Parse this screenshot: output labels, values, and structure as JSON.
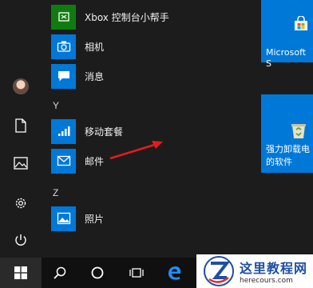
{
  "app_list": {
    "items_top": [
      {
        "label": "Xbox 控制台小帮手",
        "color": "#107c10",
        "icon": "xbox-icon"
      },
      {
        "label": "相机",
        "color": "#0078d7",
        "icon": "camera-icon"
      },
      {
        "label": "消息",
        "color": "#0078d7",
        "icon": "message-icon"
      }
    ],
    "section_y": "Y",
    "items_y": [
      {
        "label": "移动套餐",
        "color": "#0078d7",
        "icon": "signal-icon"
      },
      {
        "label": "邮件",
        "color": "#0078d7",
        "icon": "mail-icon"
      }
    ],
    "section_z": "Z",
    "items_z": [
      {
        "label": "照片",
        "color": "#0078d7",
        "icon": "photos-icon"
      }
    ]
  },
  "tiles": {
    "store": {
      "label": "Microsoft S",
      "icon": "store-bag-icon"
    },
    "uninstaller": {
      "label_line1": "强力卸载电",
      "label_line2": "的软件",
      "icon": "recycle-bin-icon"
    }
  },
  "rail": {
    "icons": [
      "avatar",
      "document-icon",
      "pictures-icon",
      "settings-icon",
      "power-icon"
    ]
  },
  "taskbar": {
    "icons": [
      "windows-start-icon",
      "search-icon",
      "cortana-circle-icon",
      "task-view-icon",
      "edge-icon"
    ]
  },
  "watermark": {
    "title": "这里教程网",
    "url": "herecours.com"
  },
  "annotation": {
    "arrow_color": "#e41b1b"
  }
}
